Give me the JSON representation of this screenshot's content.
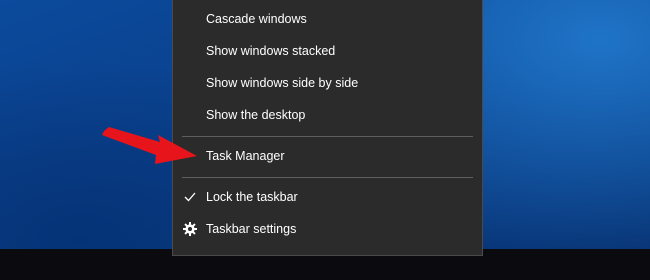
{
  "context_menu": {
    "items": [
      {
        "label": "Cascade windows"
      },
      {
        "label": "Show windows stacked"
      },
      {
        "label": "Show windows side by side"
      },
      {
        "label": "Show the desktop"
      },
      {
        "label": "Task Manager"
      },
      {
        "label": "Lock the taskbar",
        "checked": true,
        "icon": "checkmark-icon"
      },
      {
        "label": "Taskbar settings",
        "icon": "gear-icon"
      }
    ]
  },
  "annotation": {
    "arrow_color": "#e8141b",
    "points_to": "Task Manager"
  },
  "colors": {
    "menu_background": "#2b2b2b",
    "menu_text": "#ffffff",
    "separator": "#5f5f5f",
    "taskbar": "#0b0b0f"
  }
}
